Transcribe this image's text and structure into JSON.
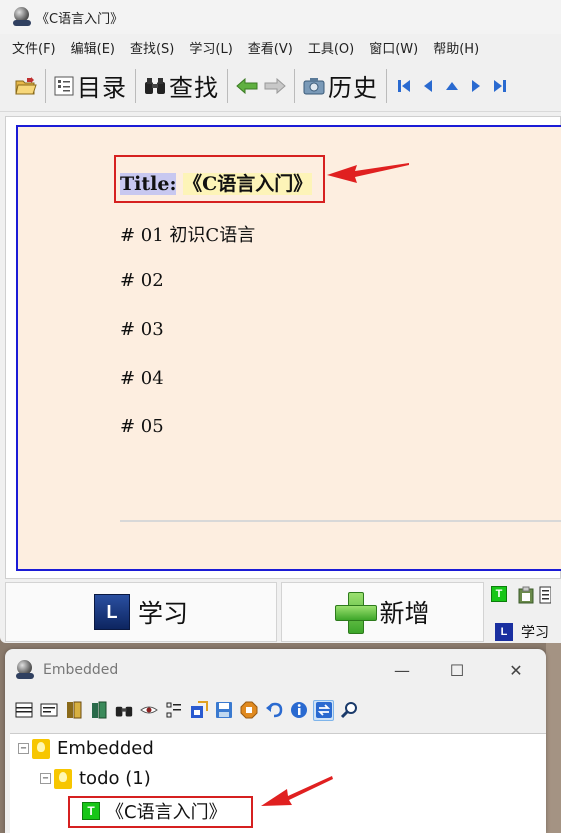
{
  "main_window": {
    "title": "《C语言入门》",
    "menu": [
      "文件(F)",
      "编辑(E)",
      "查找(S)",
      "学习(L)",
      "查看(V)",
      "工具(O)",
      "窗口(W)",
      "帮助(H)"
    ],
    "toolbar": {
      "toc_label": "目录",
      "find_label": "查找",
      "history_label": "历史"
    },
    "document": {
      "title_label": "Title:",
      "title_value": "《C语言入门》",
      "headings": [
        "# 01 初识C语言",
        "# 02",
        "# 03",
        "# 04",
        "# 05"
      ]
    },
    "bottom": {
      "learn_icon_letter": "L",
      "learn_label": "学习",
      "add_label": "新增",
      "mini_t_letter": "T",
      "mini_l_letter": "L",
      "mini_learn_label": "学习"
    }
  },
  "embedded_window": {
    "title": "Embedded",
    "tree": {
      "root": "Embedded",
      "child": "todo (1)",
      "leaf_icon_letter": "T",
      "leaf": "《C语言入门》"
    }
  },
  "colors": {
    "content_bg": "#fdeee0",
    "content_border": "#1b1bd6",
    "annotation_red": "#d62020",
    "title_label_bg": "#c8c8f0",
    "title_value_bg": "#fdf4b8"
  }
}
